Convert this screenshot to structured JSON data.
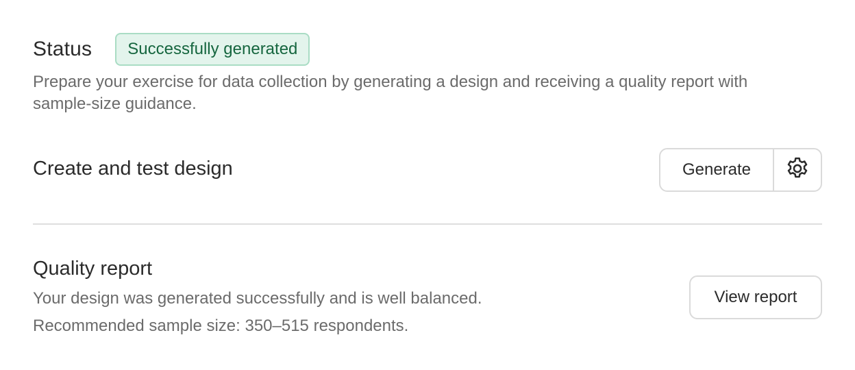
{
  "status": {
    "title": "Status",
    "badge": "Successfully generated",
    "badge_colors": {
      "background": "#e3f4ec",
      "border": "#a9dcc4",
      "text": "#16663f"
    },
    "description": "Prepare your exercise for data collection by generating a design and receiving a quality report with sample-size guidance."
  },
  "design": {
    "label": "Create and test design",
    "generate_label": "Generate",
    "settings_icon": "gear-icon"
  },
  "quality": {
    "title": "Quality report",
    "line1": "Your design was generated successfully and is well balanced.",
    "line2": "Recommended sample size: 350–515 respondents.",
    "view_label": "View report"
  }
}
